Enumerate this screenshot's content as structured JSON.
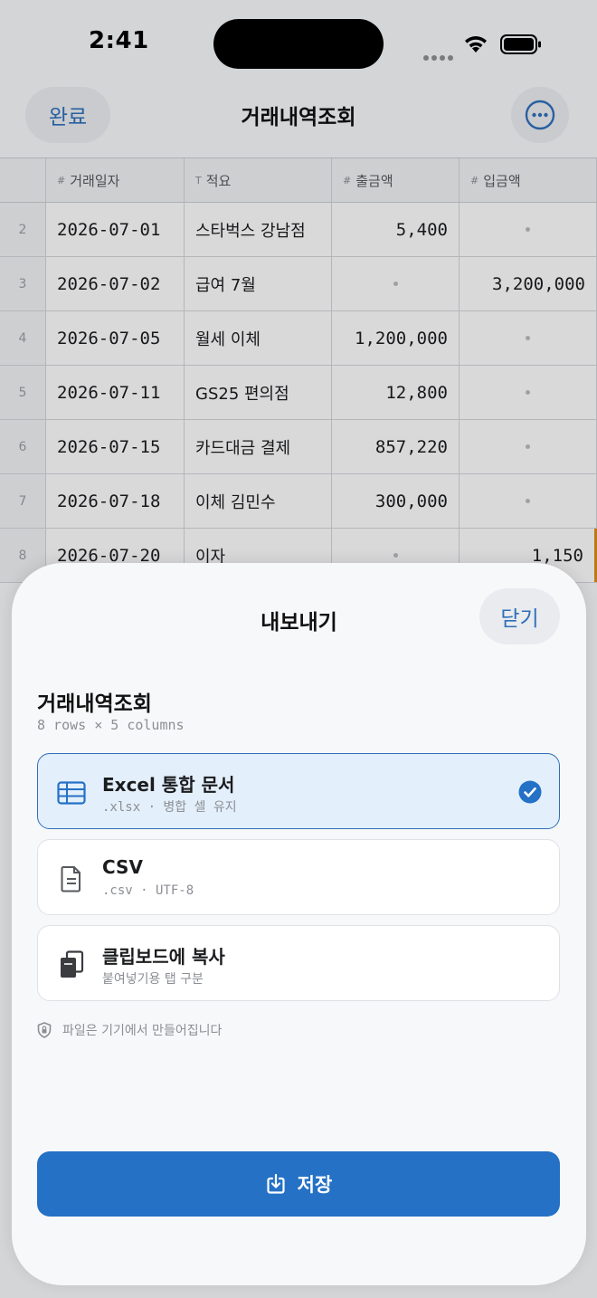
{
  "status": {
    "time": "2:41"
  },
  "nav": {
    "done_label": "완료",
    "title": "거래내역조회",
    "more_icon": "ellipsis-circle-icon"
  },
  "grid": {
    "columns": [
      {
        "type": "#",
        "label": "거래일자"
      },
      {
        "type": "T",
        "label": "적요"
      },
      {
        "type": "#",
        "label": "출금액"
      },
      {
        "type": "#",
        "label": "입금액"
      }
    ],
    "rows": [
      {
        "index": "2",
        "date": "2026-07-01",
        "memo": "스타벅스 강남점",
        "out": "5,400",
        "in": ""
      },
      {
        "index": "3",
        "date": "2026-07-02",
        "memo": "급여 7월",
        "out": "",
        "in": "3,200,000"
      },
      {
        "index": "4",
        "date": "2026-07-05",
        "memo": "월세 이체",
        "out": "1,200,000",
        "in": ""
      },
      {
        "index": "5",
        "date": "2026-07-11",
        "memo": "GS25 편의점",
        "out": "12,800",
        "in": ""
      },
      {
        "index": "6",
        "date": "2026-07-15",
        "memo": "카드대금 결제",
        "out": "857,220",
        "in": ""
      },
      {
        "index": "7",
        "date": "2026-07-18",
        "memo": "이체 김민수",
        "out": "300,000",
        "in": ""
      },
      {
        "index": "8",
        "date": "2026-07-20",
        "memo": "이자",
        "out": "",
        "in": "1,150"
      }
    ]
  },
  "sheet": {
    "title": "내보내기",
    "close_label": "닫기",
    "doc_title": "거래내역조회",
    "doc_meta": "8 rows × 5 columns",
    "options": [
      {
        "label": "Excel 통합 문서",
        "sub": ".xlsx · 병합 셀 유지",
        "icon": "table-icon",
        "selected": true
      },
      {
        "label": "CSV",
        "sub": ".csv · UTF-8",
        "icon": "document-icon",
        "selected": false
      },
      {
        "label": "클립보드에 복사",
        "sub": "붙여넣기용 탭 구분",
        "icon": "clipboard-copy-icon",
        "selected": false
      }
    ],
    "note": "파일은 기기에서 만들어집니다",
    "save_label": "저장"
  },
  "colors": {
    "accent": "#2471c5",
    "selected_bg": "#e3effb",
    "row_highlight": "#d88a1a"
  }
}
